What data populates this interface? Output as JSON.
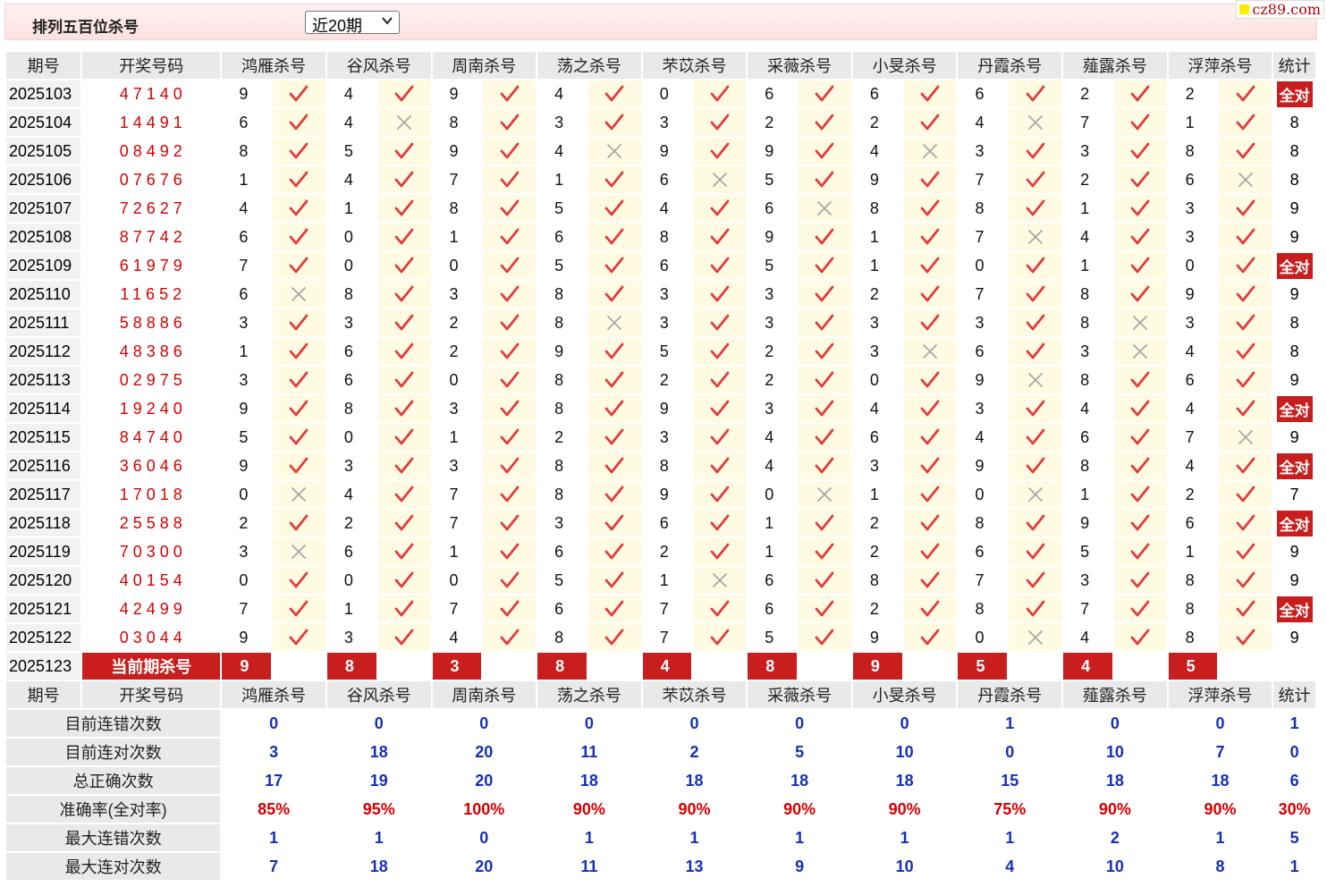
{
  "title": "排列五百位杀号",
  "range_select": {
    "selected": "近20期"
  },
  "brand": "cz89.com",
  "header": {
    "period": "期号",
    "winning": "开奖号码",
    "experts": [
      "鸿雁杀号",
      "谷风杀号",
      "周南杀号",
      "荡之杀号",
      "芣苡杀号",
      "采薇杀号",
      "小旻杀号",
      "丹霞杀号",
      "薤露杀号",
      "浮萍杀号"
    ],
    "stat": "统计"
  },
  "rows": [
    {
      "period": "2025103",
      "win": "47140",
      "nums": [
        9,
        4,
        9,
        4,
        0,
        6,
        6,
        6,
        2,
        2
      ],
      "marks": [
        1,
        1,
        1,
        1,
        1,
        1,
        1,
        1,
        1,
        1
      ],
      "stat": "全对"
    },
    {
      "period": "2025104",
      "win": "14491",
      "nums": [
        6,
        4,
        8,
        3,
        3,
        2,
        2,
        4,
        7,
        1
      ],
      "marks": [
        1,
        0,
        1,
        1,
        1,
        1,
        1,
        0,
        1,
        1
      ],
      "stat": "8"
    },
    {
      "period": "2025105",
      "win": "08492",
      "nums": [
        8,
        5,
        9,
        4,
        9,
        9,
        4,
        3,
        3,
        8
      ],
      "marks": [
        1,
        1,
        1,
        0,
        1,
        1,
        0,
        1,
        1,
        1
      ],
      "stat": "8"
    },
    {
      "period": "2025106",
      "win": "07676",
      "nums": [
        1,
        4,
        7,
        1,
        6,
        5,
        9,
        7,
        2,
        6
      ],
      "marks": [
        1,
        1,
        1,
        1,
        0,
        1,
        1,
        1,
        1,
        0
      ],
      "stat": "8"
    },
    {
      "period": "2025107",
      "win": "72627",
      "nums": [
        4,
        1,
        8,
        5,
        4,
        6,
        8,
        8,
        1,
        3
      ],
      "marks": [
        1,
        1,
        1,
        1,
        1,
        0,
        1,
        1,
        1,
        1
      ],
      "stat": "9"
    },
    {
      "period": "2025108",
      "win": "87742",
      "nums": [
        6,
        0,
        1,
        6,
        8,
        9,
        1,
        7,
        4,
        3
      ],
      "marks": [
        1,
        1,
        1,
        1,
        1,
        1,
        1,
        0,
        1,
        1
      ],
      "stat": "9"
    },
    {
      "period": "2025109",
      "win": "61979",
      "nums": [
        7,
        0,
        0,
        5,
        6,
        5,
        1,
        0,
        1,
        0
      ],
      "marks": [
        1,
        1,
        1,
        1,
        1,
        1,
        1,
        1,
        1,
        1
      ],
      "stat": "全对"
    },
    {
      "period": "2025110",
      "win": "11652",
      "nums": [
        6,
        8,
        3,
        8,
        3,
        3,
        2,
        7,
        8,
        9
      ],
      "marks": [
        0,
        1,
        1,
        1,
        1,
        1,
        1,
        1,
        1,
        1
      ],
      "stat": "9"
    },
    {
      "period": "2025111",
      "win": "58886",
      "nums": [
        3,
        3,
        2,
        8,
        3,
        3,
        3,
        3,
        8,
        3
      ],
      "marks": [
        1,
        1,
        1,
        0,
        1,
        1,
        1,
        1,
        0,
        1
      ],
      "stat": "8"
    },
    {
      "period": "2025112",
      "win": "48386",
      "nums": [
        1,
        6,
        2,
        9,
        5,
        2,
        3,
        6,
        3,
        4
      ],
      "marks": [
        1,
        1,
        1,
        1,
        1,
        1,
        0,
        1,
        0,
        1
      ],
      "stat": "8"
    },
    {
      "period": "2025113",
      "win": "02975",
      "nums": [
        3,
        6,
        0,
        8,
        2,
        2,
        0,
        9,
        8,
        6
      ],
      "marks": [
        1,
        1,
        1,
        1,
        1,
        1,
        1,
        0,
        1,
        1
      ],
      "stat": "9"
    },
    {
      "period": "2025114",
      "win": "19240",
      "nums": [
        9,
        8,
        3,
        8,
        9,
        3,
        4,
        3,
        4,
        4
      ],
      "marks": [
        1,
        1,
        1,
        1,
        1,
        1,
        1,
        1,
        1,
        1
      ],
      "stat": "全对"
    },
    {
      "period": "2025115",
      "win": "84740",
      "nums": [
        5,
        0,
        1,
        2,
        3,
        4,
        6,
        4,
        6,
        7
      ],
      "marks": [
        1,
        1,
        1,
        1,
        1,
        1,
        1,
        1,
        1,
        0
      ],
      "stat": "9"
    },
    {
      "period": "2025116",
      "win": "36046",
      "nums": [
        9,
        3,
        3,
        8,
        8,
        4,
        3,
        9,
        8,
        4
      ],
      "marks": [
        1,
        1,
        1,
        1,
        1,
        1,
        1,
        1,
        1,
        1
      ],
      "stat": "全对"
    },
    {
      "period": "2025117",
      "win": "17018",
      "nums": [
        0,
        4,
        7,
        8,
        9,
        0,
        1,
        0,
        1,
        2
      ],
      "marks": [
        0,
        1,
        1,
        1,
        1,
        0,
        1,
        0,
        1,
        1
      ],
      "stat": "7"
    },
    {
      "period": "2025118",
      "win": "25588",
      "nums": [
        2,
        2,
        7,
        3,
        6,
        1,
        2,
        8,
        9,
        6
      ],
      "marks": [
        1,
        1,
        1,
        1,
        1,
        1,
        1,
        1,
        1,
        1
      ],
      "stat": "全对"
    },
    {
      "period": "2025119",
      "win": "70300",
      "nums": [
        3,
        6,
        1,
        6,
        2,
        1,
        2,
        6,
        5,
        1
      ],
      "marks": [
        0,
        1,
        1,
        1,
        1,
        1,
        1,
        1,
        1,
        1
      ],
      "stat": "9"
    },
    {
      "period": "2025120",
      "win": "40154",
      "nums": [
        0,
        0,
        0,
        5,
        1,
        6,
        8,
        7,
        3,
        8
      ],
      "marks": [
        1,
        1,
        1,
        1,
        0,
        1,
        1,
        1,
        1,
        1
      ],
      "stat": "9"
    },
    {
      "period": "2025121",
      "win": "42499",
      "nums": [
        7,
        1,
        7,
        6,
        7,
        6,
        2,
        8,
        7,
        8
      ],
      "marks": [
        1,
        1,
        1,
        1,
        1,
        1,
        1,
        1,
        1,
        1
      ],
      "stat": "全对"
    },
    {
      "period": "2025122",
      "win": "03044",
      "nums": [
        9,
        3,
        4,
        8,
        7,
        5,
        9,
        0,
        4,
        8
      ],
      "marks": [
        1,
        1,
        1,
        1,
        1,
        1,
        1,
        0,
        1,
        1
      ],
      "stat": "9"
    }
  ],
  "current": {
    "period": "2025123",
    "label": "当前期杀号",
    "nums": [
      9,
      8,
      3,
      8,
      4,
      8,
      9,
      5,
      4,
      5
    ]
  },
  "stats": [
    {
      "label": "目前连错次数",
      "values": [
        "0",
        "0",
        "0",
        "0",
        "0",
        "0",
        "0",
        "1",
        "0",
        "0"
      ],
      "stat": "1"
    },
    {
      "label": "目前连对次数",
      "values": [
        "3",
        "18",
        "20",
        "11",
        "2",
        "5",
        "10",
        "0",
        "10",
        "7"
      ],
      "stat": "0"
    },
    {
      "label": "总正确次数",
      "values": [
        "17",
        "19",
        "20",
        "18",
        "18",
        "18",
        "18",
        "15",
        "18",
        "18"
      ],
      "stat": "6"
    },
    {
      "label": "准确率(全对率)",
      "values": [
        "85%",
        "95%",
        "100%",
        "90%",
        "90%",
        "90%",
        "90%",
        "75%",
        "90%",
        "90%"
      ],
      "stat": "30%",
      "red": true
    },
    {
      "label": "最大连错次数",
      "values": [
        "1",
        "1",
        "0",
        "1",
        "1",
        "1",
        "1",
        "1",
        "2",
        "1"
      ],
      "stat": "5"
    },
    {
      "label": "最大连对次数",
      "values": [
        "7",
        "18",
        "20",
        "11",
        "13",
        "9",
        "10",
        "4",
        "10",
        "8"
      ],
      "stat": "1"
    }
  ],
  "colors": {
    "accent_red": "#c81e1e",
    "check_red": "#e23b3b",
    "cross_gray": "#a8a8a8",
    "stat_blue": "#1530b8",
    "mark_bg": "#fffbe3"
  }
}
